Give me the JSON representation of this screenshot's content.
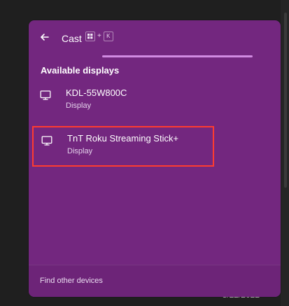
{
  "header": {
    "title": "Cast",
    "back_icon": "back-arrow-icon",
    "shortcut": {
      "win_icon": "windows-icon",
      "plus": "+",
      "key": "K"
    }
  },
  "progress": {
    "value": 1
  },
  "section": {
    "title": "Available displays"
  },
  "devices": [
    {
      "name": "KDL-55W800C",
      "type": "Display",
      "icon": "monitor-icon"
    },
    {
      "name": "TnT Roku Streaming Stick+",
      "type": "Display",
      "icon": "monitor-icon",
      "highlighted": true
    }
  ],
  "footer": {
    "link": "Find other devices"
  },
  "background": {
    "clock": "8/22/2022"
  },
  "colors": {
    "panel": "#73277f",
    "accent": "#d18be2",
    "selection": "#ff3b30"
  }
}
